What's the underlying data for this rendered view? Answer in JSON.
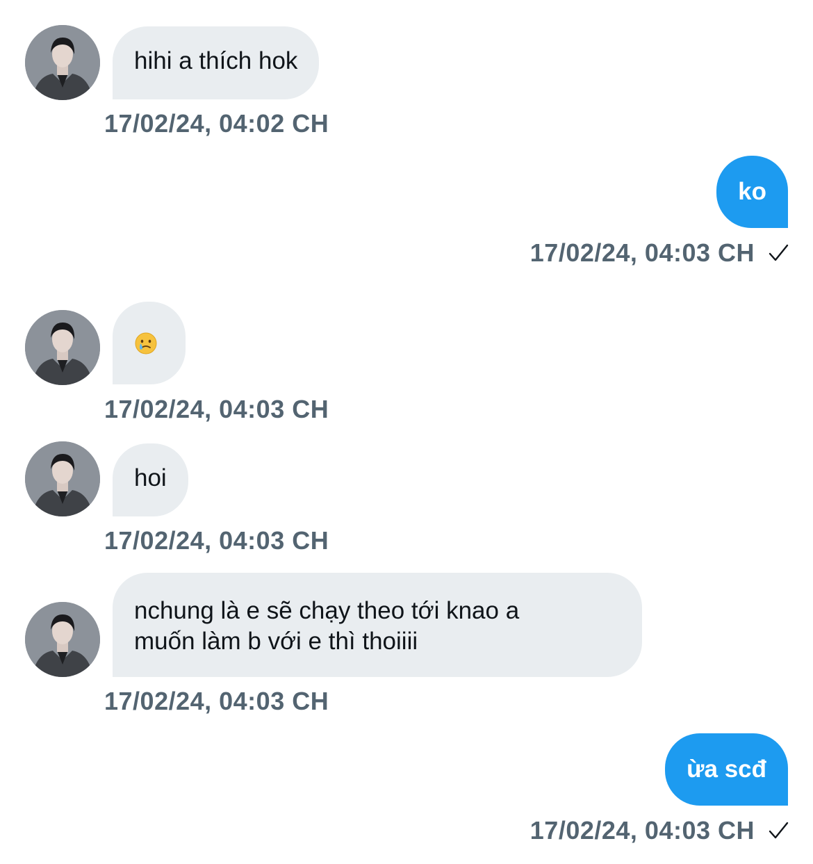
{
  "messages": [
    {
      "direction": "incoming",
      "text": "hihi a thích hok",
      "time": "17/02/24, 04:02 CH"
    },
    {
      "direction": "outgoing",
      "text": "ko",
      "time": "17/02/24, 04:03 CH",
      "status_icon": "check-icon"
    },
    {
      "direction": "incoming",
      "emoji": "😢",
      "emoji_name": "crying-face-icon",
      "time": "17/02/24, 04:03 CH"
    },
    {
      "direction": "incoming",
      "text": "hoi",
      "time": "17/02/24, 04:03 CH"
    },
    {
      "direction": "incoming",
      "lines": [
        "nchung là e sẽ chạy theo tới knao a",
        "muốn làm b với e thì thoiiii"
      ],
      "time": "17/02/24, 04:03 CH"
    },
    {
      "direction": "outgoing",
      "text": "ừa scđ",
      "time": "17/02/24, 04:03 CH",
      "status_icon": "check-icon"
    }
  ],
  "colors": {
    "incoming_bubble": "#e9edf0",
    "outgoing_bubble": "#1d9bf0",
    "timestamp": "#536471",
    "text": "#0f1419"
  }
}
